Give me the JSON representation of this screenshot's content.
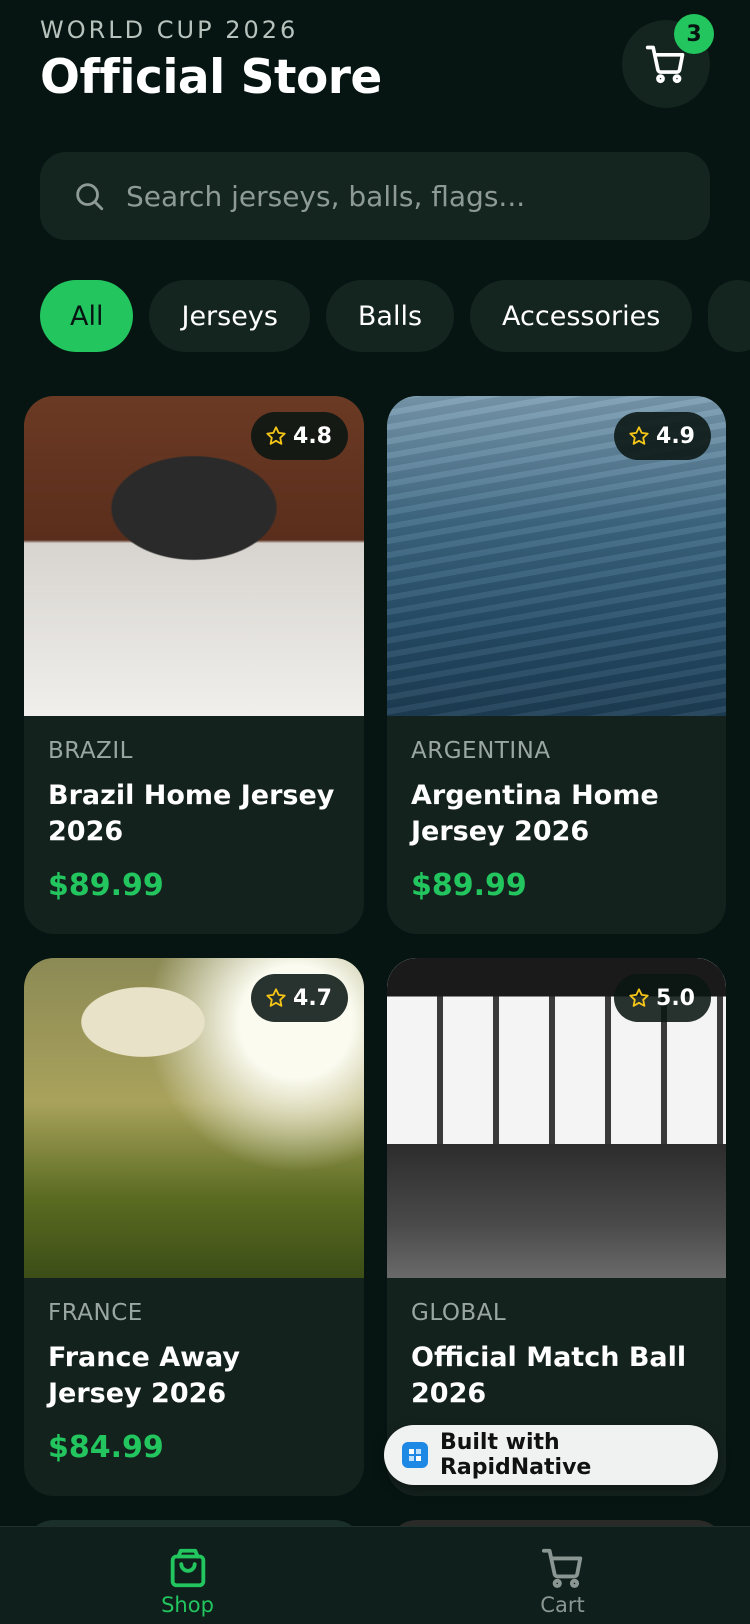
{
  "header": {
    "eyebrow": "WORLD CUP 2026",
    "title": "Official Store",
    "cart_count": "3"
  },
  "search": {
    "placeholder": "Search jerseys, balls, flags..."
  },
  "filters": [
    {
      "label": "All",
      "active": true
    },
    {
      "label": "Jerseys",
      "active": false
    },
    {
      "label": "Balls",
      "active": false
    },
    {
      "label": "Accessories",
      "active": false
    }
  ],
  "products": [
    {
      "country": "BRAZIL",
      "name": "Brazil Home Jersey 2026",
      "price": "$89.99",
      "rating": "4.8",
      "image": "photo of child reading book"
    },
    {
      "country": "ARGENTINA",
      "name": "Argentina Home Jersey 2026",
      "price": "$89.99",
      "rating": "4.9",
      "image": "photo of water surface"
    },
    {
      "country": "FRANCE",
      "name": "France Away Jersey 2026",
      "price": "$84.99",
      "rating": "4.7",
      "image": "photo of mushroom on moss"
    },
    {
      "country": "GLOBAL",
      "name": "Official Match Ball 2026",
      "price": "",
      "rating": "5.0",
      "image": "black and white cafe interior"
    }
  ],
  "badge": {
    "label": "Built with RapidNative"
  },
  "tabbar": {
    "items": [
      {
        "label": "Shop",
        "icon": "shopping-bag-icon",
        "active": true
      },
      {
        "label": "Cart",
        "icon": "cart-icon",
        "active": false
      }
    ]
  },
  "colors": {
    "background": "#061511",
    "card": "#14221e",
    "accent": "#22c55e",
    "star": "#f5c518"
  }
}
